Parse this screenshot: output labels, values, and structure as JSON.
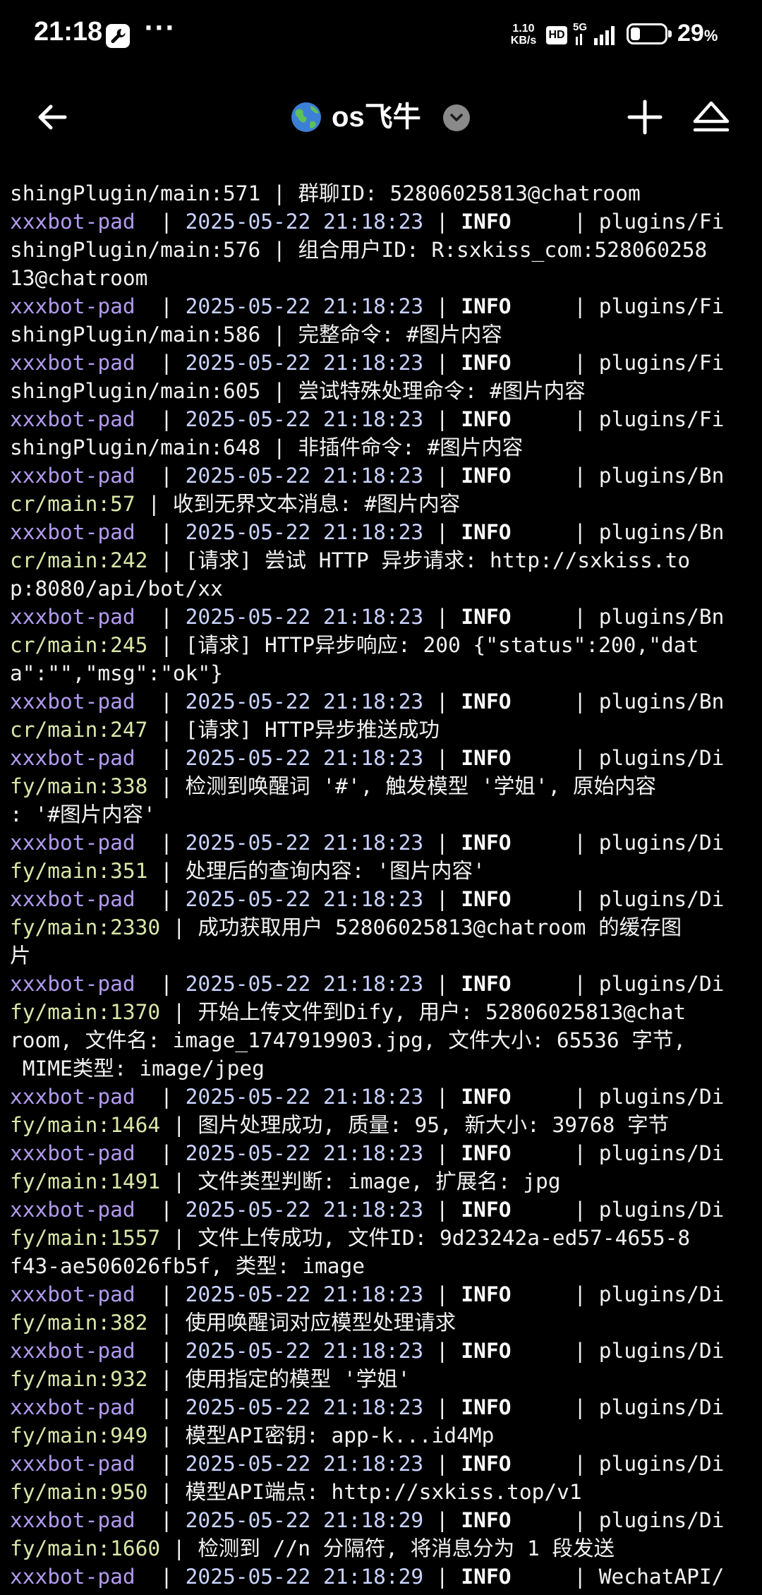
{
  "status_bar": {
    "time": "21:18",
    "dots": "···",
    "speed_top": "1.10",
    "speed_bottom": "KB/s",
    "hd": "HD",
    "network": "5G",
    "battery_percent": "29",
    "battery_suffix": "%",
    "battery_level": 0.29
  },
  "header": {
    "title": "os飞牛",
    "icons": {
      "back": "arrow-left-icon",
      "globe": "globe-icon",
      "dropdown": "chevron-down-icon",
      "add": "plus-icon",
      "eject": "eject-icon"
    }
  },
  "log": {
    "colors": {
      "service": "#b29bf0",
      "timestamp": "#c9d3ff",
      "level": "#ffffff",
      "location": "#d8e6a8"
    },
    "lines": [
      [
        {
          "c": "plain",
          "t": "shingPlugin/main:571 | 群聊ID: 52806025813@chatroom"
        }
      ],
      [
        {
          "c": "svc",
          "t": "xxxbot-pad "
        },
        {
          "c": "plain",
          "t": " | "
        },
        {
          "c": "ts",
          "t": "2025-05-22 21:18:23"
        },
        {
          "c": "plain",
          "t": " | "
        },
        {
          "c": "lvl",
          "t": "INFO"
        },
        {
          "c": "plain",
          "t": "     | plugins/Fi"
        }
      ],
      [
        {
          "c": "plain",
          "t": "shingPlugin/main:576 | 组合用户ID: R:sxkiss_com:528060258"
        }
      ],
      [
        {
          "c": "plain",
          "t": "13@chatroom"
        }
      ],
      [
        {
          "c": "svc",
          "t": "xxxbot-pad "
        },
        {
          "c": "plain",
          "t": " | "
        },
        {
          "c": "ts",
          "t": "2025-05-22 21:18:23"
        },
        {
          "c": "plain",
          "t": " | "
        },
        {
          "c": "lvl",
          "t": "INFO"
        },
        {
          "c": "plain",
          "t": "     | plugins/Fi"
        }
      ],
      [
        {
          "c": "plain",
          "t": "shingPlugin/main:586 | 完整命令: #图片内容"
        }
      ],
      [
        {
          "c": "svc",
          "t": "xxxbot-pad "
        },
        {
          "c": "plain",
          "t": " | "
        },
        {
          "c": "ts",
          "t": "2025-05-22 21:18:23"
        },
        {
          "c": "plain",
          "t": " | "
        },
        {
          "c": "lvl",
          "t": "INFO"
        },
        {
          "c": "plain",
          "t": "     | plugins/Fi"
        }
      ],
      [
        {
          "c": "plain",
          "t": "shingPlugin/main:605 | 尝试特殊处理命令: #图片内容"
        }
      ],
      [
        {
          "c": "svc",
          "t": "xxxbot-pad "
        },
        {
          "c": "plain",
          "t": " | "
        },
        {
          "c": "ts",
          "t": "2025-05-22 21:18:23"
        },
        {
          "c": "plain",
          "t": " | "
        },
        {
          "c": "lvl",
          "t": "INFO"
        },
        {
          "c": "plain",
          "t": "     | plugins/Fi"
        }
      ],
      [
        {
          "c": "plain",
          "t": "shingPlugin/main:648 | 非插件命令: #图片内容"
        }
      ],
      [
        {
          "c": "svc",
          "t": "xxxbot-pad "
        },
        {
          "c": "plain",
          "t": " | "
        },
        {
          "c": "ts",
          "t": "2025-05-22 21:18:23"
        },
        {
          "c": "plain",
          "t": " | "
        },
        {
          "c": "lvl",
          "t": "INFO"
        },
        {
          "c": "plain",
          "t": "     | plugins/Bn"
        }
      ],
      [
        {
          "c": "loc",
          "t": "cr/main:57"
        },
        {
          "c": "plain",
          "t": " | 收到无界文本消息: #图片内容"
        }
      ],
      [
        {
          "c": "svc",
          "t": "xxxbot-pad "
        },
        {
          "c": "plain",
          "t": " | "
        },
        {
          "c": "ts",
          "t": "2025-05-22 21:18:23"
        },
        {
          "c": "plain",
          "t": " | "
        },
        {
          "c": "lvl",
          "t": "INFO"
        },
        {
          "c": "plain",
          "t": "     | plugins/Bn"
        }
      ],
      [
        {
          "c": "loc",
          "t": "cr/main:242"
        },
        {
          "c": "plain",
          "t": " | [请求] 尝试 HTTP 异步请求: http://sxkiss.to"
        }
      ],
      [
        {
          "c": "plain",
          "t": "p:8080/api/bot/xx"
        }
      ],
      [
        {
          "c": "svc",
          "t": "xxxbot-pad "
        },
        {
          "c": "plain",
          "t": " | "
        },
        {
          "c": "ts",
          "t": "2025-05-22 21:18:23"
        },
        {
          "c": "plain",
          "t": " | "
        },
        {
          "c": "lvl",
          "t": "INFO"
        },
        {
          "c": "plain",
          "t": "     | plugins/Bn"
        }
      ],
      [
        {
          "c": "loc",
          "t": "cr/main:245"
        },
        {
          "c": "plain",
          "t": " | [请求] HTTP异步响应: 200 {\"status\":200,\"dat"
        }
      ],
      [
        {
          "c": "plain",
          "t": "a\":\"\",\"msg\":\"ok\"}"
        }
      ],
      [
        {
          "c": "svc",
          "t": "xxxbot-pad "
        },
        {
          "c": "plain",
          "t": " | "
        },
        {
          "c": "ts",
          "t": "2025-05-22 21:18:23"
        },
        {
          "c": "plain",
          "t": " | "
        },
        {
          "c": "lvl",
          "t": "INFO"
        },
        {
          "c": "plain",
          "t": "     | plugins/Bn"
        }
      ],
      [
        {
          "c": "loc",
          "t": "cr/main:247"
        },
        {
          "c": "plain",
          "t": " | [请求] HTTP异步推送成功"
        }
      ],
      [
        {
          "c": "svc",
          "t": "xxxbot-pad "
        },
        {
          "c": "plain",
          "t": " | "
        },
        {
          "c": "ts",
          "t": "2025-05-22 21:18:23"
        },
        {
          "c": "plain",
          "t": " | "
        },
        {
          "c": "lvl",
          "t": "INFO"
        },
        {
          "c": "plain",
          "t": "     | plugins/Di"
        }
      ],
      [
        {
          "c": "loc",
          "t": "fy/main:338"
        },
        {
          "c": "plain",
          "t": " | 检测到唤醒词 '#', 触发模型 '学姐', 原始内容"
        }
      ],
      [
        {
          "c": "plain",
          "t": ": '#图片内容'"
        }
      ],
      [
        {
          "c": "svc",
          "t": "xxxbot-pad "
        },
        {
          "c": "plain",
          "t": " | "
        },
        {
          "c": "ts",
          "t": "2025-05-22 21:18:23"
        },
        {
          "c": "plain",
          "t": " | "
        },
        {
          "c": "lvl",
          "t": "INFO"
        },
        {
          "c": "plain",
          "t": "     | plugins/Di"
        }
      ],
      [
        {
          "c": "loc",
          "t": "fy/main:351"
        },
        {
          "c": "plain",
          "t": " | 处理后的查询内容: '图片内容'"
        }
      ],
      [
        {
          "c": "svc",
          "t": "xxxbot-pad "
        },
        {
          "c": "plain",
          "t": " | "
        },
        {
          "c": "ts",
          "t": "2025-05-22 21:18:23"
        },
        {
          "c": "plain",
          "t": " | "
        },
        {
          "c": "lvl",
          "t": "INFO"
        },
        {
          "c": "plain",
          "t": "     | plugins/Di"
        }
      ],
      [
        {
          "c": "loc",
          "t": "fy/main:2330"
        },
        {
          "c": "plain",
          "t": " | 成功获取用户 52806025813@chatroom 的缓存图"
        }
      ],
      [
        {
          "c": "plain",
          "t": "片"
        }
      ],
      [
        {
          "c": "svc",
          "t": "xxxbot-pad "
        },
        {
          "c": "plain",
          "t": " | "
        },
        {
          "c": "ts",
          "t": "2025-05-22 21:18:23"
        },
        {
          "c": "plain",
          "t": " | "
        },
        {
          "c": "lvl",
          "t": "INFO"
        },
        {
          "c": "plain",
          "t": "     | plugins/Di"
        }
      ],
      [
        {
          "c": "loc",
          "t": "fy/main:1370"
        },
        {
          "c": "plain",
          "t": " | 开始上传文件到Dify, 用户: 52806025813@chat"
        }
      ],
      [
        {
          "c": "plain",
          "t": "room, 文件名: image_1747919903.jpg, 文件大小: 65536 字节,"
        }
      ],
      [
        {
          "c": "plain",
          "t": " MIME类型: image/jpeg"
        }
      ],
      [
        {
          "c": "svc",
          "t": "xxxbot-pad "
        },
        {
          "c": "plain",
          "t": " | "
        },
        {
          "c": "ts",
          "t": "2025-05-22 21:18:23"
        },
        {
          "c": "plain",
          "t": " | "
        },
        {
          "c": "lvl",
          "t": "INFO"
        },
        {
          "c": "plain",
          "t": "     | plugins/Di"
        }
      ],
      [
        {
          "c": "loc",
          "t": "fy/main:1464"
        },
        {
          "c": "plain",
          "t": " | 图片处理成功, 质量: 95, 新大小: 39768 字节"
        }
      ],
      [
        {
          "c": "svc",
          "t": "xxxbot-pad "
        },
        {
          "c": "plain",
          "t": " | "
        },
        {
          "c": "ts",
          "t": "2025-05-22 21:18:23"
        },
        {
          "c": "plain",
          "t": " | "
        },
        {
          "c": "lvl",
          "t": "INFO"
        },
        {
          "c": "plain",
          "t": "     | plugins/Di"
        }
      ],
      [
        {
          "c": "loc",
          "t": "fy/main:1491"
        },
        {
          "c": "plain",
          "t": " | 文件类型判断: image, 扩展名: jpg"
        }
      ],
      [
        {
          "c": "svc",
          "t": "xxxbot-pad "
        },
        {
          "c": "plain",
          "t": " | "
        },
        {
          "c": "ts",
          "t": "2025-05-22 21:18:23"
        },
        {
          "c": "plain",
          "t": " | "
        },
        {
          "c": "lvl",
          "t": "INFO"
        },
        {
          "c": "plain",
          "t": "     | plugins/Di"
        }
      ],
      [
        {
          "c": "loc",
          "t": "fy/main:1557"
        },
        {
          "c": "plain",
          "t": " | 文件上传成功, 文件ID: 9d23242a-ed57-4655-8"
        }
      ],
      [
        {
          "c": "plain",
          "t": "f43-ae506026fb5f, 类型: image"
        }
      ],
      [
        {
          "c": "svc",
          "t": "xxxbot-pad "
        },
        {
          "c": "plain",
          "t": " | "
        },
        {
          "c": "ts",
          "t": "2025-05-22 21:18:23"
        },
        {
          "c": "plain",
          "t": " | "
        },
        {
          "c": "lvl",
          "t": "INFO"
        },
        {
          "c": "plain",
          "t": "     | plugins/Di"
        }
      ],
      [
        {
          "c": "loc",
          "t": "fy/main:382"
        },
        {
          "c": "plain",
          "t": " | 使用唤醒词对应模型处理请求"
        }
      ],
      [
        {
          "c": "svc",
          "t": "xxxbot-pad "
        },
        {
          "c": "plain",
          "t": " | "
        },
        {
          "c": "ts",
          "t": "2025-05-22 21:18:23"
        },
        {
          "c": "plain",
          "t": " | "
        },
        {
          "c": "lvl",
          "t": "INFO"
        },
        {
          "c": "plain",
          "t": "     | plugins/Di"
        }
      ],
      [
        {
          "c": "loc",
          "t": "fy/main:932"
        },
        {
          "c": "plain",
          "t": " | 使用指定的模型 '学姐'"
        }
      ],
      [
        {
          "c": "svc",
          "t": "xxxbot-pad "
        },
        {
          "c": "plain",
          "t": " | "
        },
        {
          "c": "ts",
          "t": "2025-05-22 21:18:23"
        },
        {
          "c": "plain",
          "t": " | "
        },
        {
          "c": "lvl",
          "t": "INFO"
        },
        {
          "c": "plain",
          "t": "     | plugins/Di"
        }
      ],
      [
        {
          "c": "loc",
          "t": "fy/main:949"
        },
        {
          "c": "plain",
          "t": " | 模型API密钥: app-k...id4Mp"
        }
      ],
      [
        {
          "c": "svc",
          "t": "xxxbot-pad "
        },
        {
          "c": "plain",
          "t": " | "
        },
        {
          "c": "ts",
          "t": "2025-05-22 21:18:23"
        },
        {
          "c": "plain",
          "t": " | "
        },
        {
          "c": "lvl",
          "t": "INFO"
        },
        {
          "c": "plain",
          "t": "     | plugins/Di"
        }
      ],
      [
        {
          "c": "loc",
          "t": "fy/main:950"
        },
        {
          "c": "plain",
          "t": " | 模型API端点: http://sxkiss.top/v1"
        }
      ],
      [
        {
          "c": "svc",
          "t": "xxxbot-pad "
        },
        {
          "c": "plain",
          "t": " | "
        },
        {
          "c": "ts",
          "t": "2025-05-22 21:18:29"
        },
        {
          "c": "plain",
          "t": " | "
        },
        {
          "c": "lvl",
          "t": "INFO"
        },
        {
          "c": "plain",
          "t": "     | plugins/Di"
        }
      ],
      [
        {
          "c": "loc",
          "t": "fy/main:1660"
        },
        {
          "c": "plain",
          "t": " | 检测到 //n 分隔符, 将消息分为 1 段发送"
        }
      ],
      [
        {
          "c": "svc",
          "t": "xxxbot-pad "
        },
        {
          "c": "plain",
          "t": " | "
        },
        {
          "c": "ts",
          "t": "2025-05-22 21:18:29"
        },
        {
          "c": "plain",
          "t": " | "
        },
        {
          "c": "lvl",
          "t": "INFO"
        },
        {
          "c": "plain",
          "t": "     | WechatAPI/"
        }
      ]
    ]
  }
}
